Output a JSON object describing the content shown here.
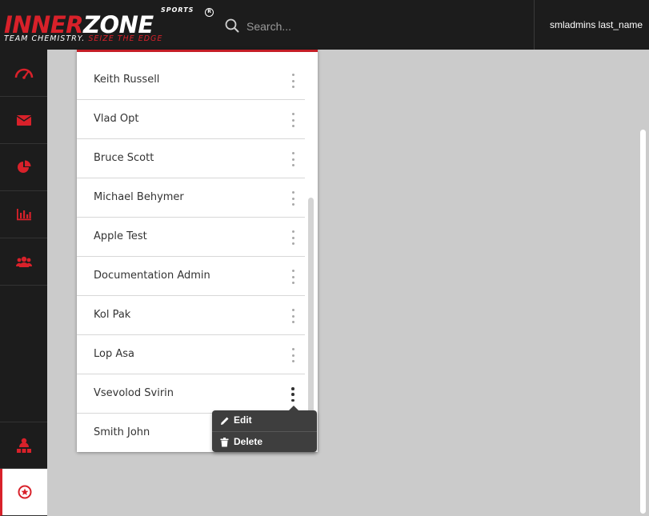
{
  "header": {
    "logo": {
      "brand_part1": "INNER",
      "brand_part2": "ZONE",
      "sports": "SPORTS",
      "registered": "R",
      "tagline_part1": "TEAM CHEMISTRY.",
      "tagline_part2": "SEIZE THE EDGE"
    },
    "search": {
      "placeholder": "Search...",
      "value": "",
      "icon": "search-icon"
    },
    "user_name": "smladmins last_name"
  },
  "sidebar": {
    "items": [
      {
        "icon": "speedometer-icon",
        "active": false
      },
      {
        "icon": "envelope-icon",
        "active": false
      },
      {
        "icon": "pie-chart-icon",
        "active": false
      },
      {
        "icon": "bar-chart-icon",
        "active": false
      },
      {
        "icon": "users-icon",
        "active": false
      },
      {
        "icon": "org-chart-icon",
        "active": false
      },
      {
        "icon": "star-circle-icon",
        "active": true
      }
    ]
  },
  "user_list": {
    "rows": [
      {
        "name": "Keith Russell"
      },
      {
        "name": "Vlad Opt"
      },
      {
        "name": "Bruce Scott"
      },
      {
        "name": "Michael Behymer"
      },
      {
        "name": "Apple Test"
      },
      {
        "name": "Documentation Admin"
      },
      {
        "name": "Kol Pak"
      },
      {
        "name": "Lop Asa"
      },
      {
        "name": "Vsevolod Svirin"
      },
      {
        "name": "Smith John"
      }
    ]
  },
  "context_menu": {
    "items": [
      {
        "label": "Edit",
        "icon": "pencil-icon"
      },
      {
        "label": "Delete",
        "icon": "trash-icon"
      }
    ]
  },
  "colors": {
    "accent": "#d8212a",
    "dark": "#1c1c1c",
    "background": "#cbcbcb"
  }
}
